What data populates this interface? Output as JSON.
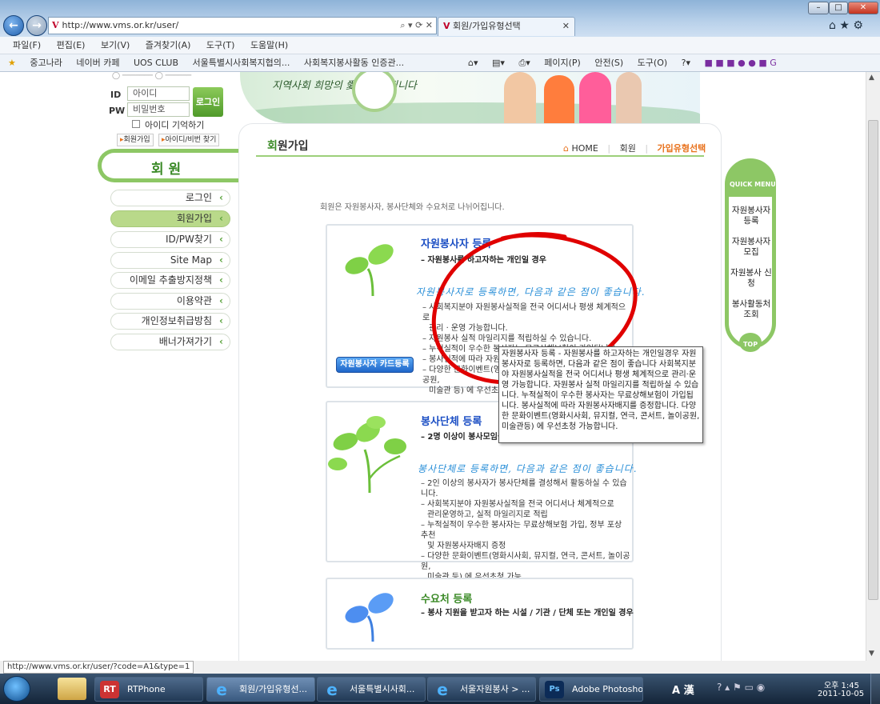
{
  "browser": {
    "url": "http://www.vms.or.kr/user/",
    "tab_title": "회원/가입유형선택",
    "menu": [
      "파일(F)",
      "편집(E)",
      "보기(V)",
      "즐겨찾기(A)",
      "도구(T)",
      "도움말(H)"
    ],
    "favorites": [
      "중고나라",
      "네이버 카페",
      "UOS CLUB",
      "서울특별시사회복지협의...",
      "사회복지봉사활동 인증관..."
    ],
    "toolbar": [
      "페이지(P)",
      "안전(S)",
      "도구(O)"
    ],
    "status_url": "http://www.vms.or.kr/user/?code=A1&type=1"
  },
  "login": {
    "id_label": "ID",
    "pw_label": "PW",
    "id_placeholder": "아이디",
    "pw_placeholder": "비밀번호",
    "login_button": "로그인",
    "remember": "아이디 기억하기",
    "join_link": "회원가입",
    "find_link": "아이디/비번 찾기"
  },
  "banner": {
    "text": "지역사회 희망의  愛  나누어집니다"
  },
  "sidebar": {
    "title": "회 원",
    "items": [
      {
        "label": "로그인"
      },
      {
        "label": "회원가입"
      },
      {
        "label": "ID/PW찾기"
      },
      {
        "label": "Site Map"
      },
      {
        "label": "이메일 추출방지정책"
      },
      {
        "label": "이용약관"
      },
      {
        "label": "개인정보취급방침"
      },
      {
        "label": "배너가져가기"
      }
    ]
  },
  "main": {
    "title_first": "회",
    "title_rest": "원가입",
    "breadcrumb": [
      "HOME",
      "회원",
      "가입유형선택"
    ],
    "intro": "회원은 자원봉사자, 봉사단체와 수요처로 나뉘어집니다."
  },
  "cards": [
    {
      "title": "자원봉사자 등록",
      "subtitle": "– 자원봉사를 하고자하는 개인일 경우",
      "hand": "자원봉사자로 등록하면, 다음과 같은 점이 좋습니다.",
      "lines": [
        "– 사회복지분야 자원봉사실적을 전국 어디서나 평생 체계적으로",
        "관리 · 운영 가능합니다.",
        "– 자원봉사 실적 마일리지를 적립하실 수 있습니다.",
        "– 누적실적이 우수한 봉사자는 무료상해보험이 가입됩니다.",
        "– 봉사실적에 따라 자원봉사자배지를 증정합니다.",
        "– 다양한 문화이벤트(영화시사회, 뮤지컬, 연극, 콘서트, 놀이공원,",
        "미술관 등) 에 우선초청 가능합니다."
      ],
      "button": "자원봉사자 카드등록"
    },
    {
      "title": "봉사단체 등록",
      "subtitle": "– 2명 이상이 봉사모임을 결성하여 활동할 경우",
      "hand": "봉사단체로 등록하면, 다음과 같은 점이 좋습니다.",
      "lines": [
        "– 2인 이상의 봉사자가 봉사단체를 결성해서 활동하실 수 있습니다.",
        "– 사회복지분야 자원봉사실적을 전국 어디서나 체계적으로",
        "관리운영하고, 실적 마일리지로 적립",
        "– 누적실적이 우수한 봉사자는 무료상해보험 가입, 정부 포상 추천",
        "및 자원봉사자배지 증정",
        "– 다양한 문화이벤트(영화시사회, 뮤지컬, 연극, 콘서트, 놀이공원,",
        "미술관 등) 에 우선초청 가능"
      ]
    },
    {
      "title": "수요처 등록",
      "subtitle": "– 봉사 지원을 받고자 하는 시설 / 기관 / 단체 또는 개인일 경우"
    }
  ],
  "tooltip": {
    "text": "자원봉사자 등록 - 자원봉사를 하고자하는 개인일경우 자원봉사자로 등록하면, 다음과 같은 점이 좋습니다 사회복지분야 자원봉사실적을 전국 어디서나 평생 체계적으로 관리·운영 가능합니다. 자원봉사 실적 마일리지를 적립하실 수 있습니다. 누적실적이 우수한 봉사자는 무료상해보험이 가입됩니다. 봉사실적에 따라 자원봉사자배지를 증정합니다. 다양한 문화이벤트(영화시사회, 뮤지컬, 연극, 콘서트, 놀이공원, 미술관등) 에 우선초청 가능합니다."
  },
  "quick_menu": {
    "title": "QUICK MENU",
    "items": [
      "자원봉사자 등록",
      "자원봉사자 모집",
      "자원봉사 신청",
      "봉사활동처 조회"
    ],
    "top": "TOP"
  },
  "taskbar": {
    "items": [
      "RTPhone",
      "회원/가입유형선...",
      "서울특별시사회...",
      "서울자원봉사 > ...",
      "Adobe Photosho..."
    ],
    "ime": "A 漢",
    "clock_time": "오후 1:45",
    "clock_date": "2011-10-05"
  },
  "colors": {
    "accent_green": "#5aa33c",
    "title_blue": "#1b4ec4",
    "highlight_orange": "#e8701a",
    "annotation_red": "#e00000"
  }
}
